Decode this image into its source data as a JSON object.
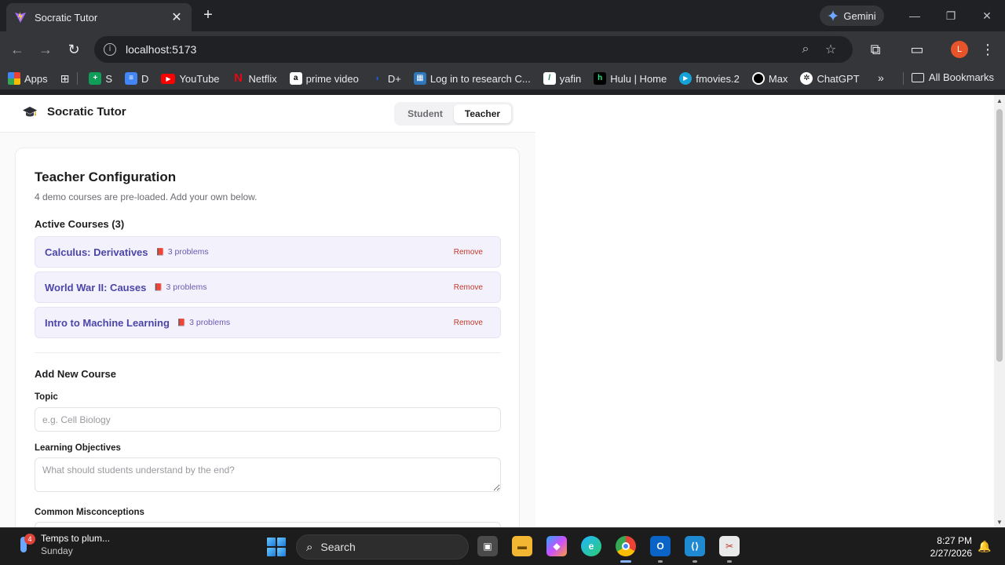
{
  "browser": {
    "tab_title": "Socratic Tutor",
    "tab_close": "✕",
    "new_tab": "+",
    "gemini_label": "Gemini",
    "url": "localhost:5173",
    "profile_initial": "L",
    "window_controls": {
      "minimize": "—",
      "restore": "❐",
      "close": "✕"
    },
    "bookmarks": [
      {
        "label": "Apps",
        "icon": "apps-grid-icon",
        "color": "#e8eaed"
      },
      {
        "label": "S",
        "icon": "sheets-icon",
        "color": "#0f9d58"
      },
      {
        "label": "D",
        "icon": "docs-icon",
        "color": "#4285f4"
      },
      {
        "label": "YouTube",
        "icon": "youtube-icon",
        "color": "#ff0000"
      },
      {
        "label": "Netflix",
        "icon": "netflix-icon",
        "color": "#e50914"
      },
      {
        "label": "prime video",
        "icon": "amazon-icon",
        "color": "#ffffff"
      },
      {
        "label": "D+",
        "icon": "disney-plus-icon",
        "color": "#113ccf"
      },
      {
        "label": "Log in to research C...",
        "icon": "research-icon",
        "color": "#2e77bb"
      },
      {
        "label": "yafin",
        "icon": "yafin-icon",
        "color": "#ffffff"
      },
      {
        "label": "Hulu | Home",
        "icon": "hulu-icon",
        "color": "#000000"
      },
      {
        "label": "fmovies.2",
        "icon": "fmovies-icon",
        "color": "#16a2d7"
      },
      {
        "label": "Max",
        "icon": "max-icon",
        "color": "#000000"
      },
      {
        "label": "ChatGPT",
        "icon": "chatgpt-icon",
        "color": "#ffffff"
      }
    ],
    "bookmarks_more": "»",
    "all_bookmarks": "All Bookmarks"
  },
  "app": {
    "brand_name": "Socratic Tutor",
    "brand_icon": "graduation-cap-icon",
    "modes": [
      {
        "label": "Student",
        "active": false
      },
      {
        "label": "Teacher",
        "active": true
      }
    ],
    "config": {
      "title": "Teacher Configuration",
      "subtitle": "4 demo courses are pre-loaded. Add your own below.",
      "active_heading": "Active Courses (3)",
      "courses": [
        {
          "name": "Calculus: Derivatives",
          "problems": "3 problems",
          "remove": "Remove"
        },
        {
          "name": "World War II: Causes",
          "problems": "3 problems",
          "remove": "Remove"
        },
        {
          "name": "Intro to Machine Learning",
          "problems": "3 problems",
          "remove": "Remove"
        }
      ],
      "add_heading": "Add New Course",
      "fields": {
        "topic_label": "Topic",
        "topic_placeholder": "e.g. Cell Biology",
        "objectives_label": "Learning Objectives",
        "objectives_placeholder": "What should students understand by the end?",
        "misconceptions_label": "Common Misconceptions"
      }
    }
  },
  "taskbar": {
    "weather_title": "Temps to plum...",
    "weather_day": "Sunday",
    "weather_badge": "4",
    "search_label": "Search",
    "time": "8:27 PM",
    "date": "2/27/2026"
  },
  "colors": {
    "accent": "#4b45a8",
    "remove": "#c0392b",
    "course_bg": "#f3f2fc"
  }
}
